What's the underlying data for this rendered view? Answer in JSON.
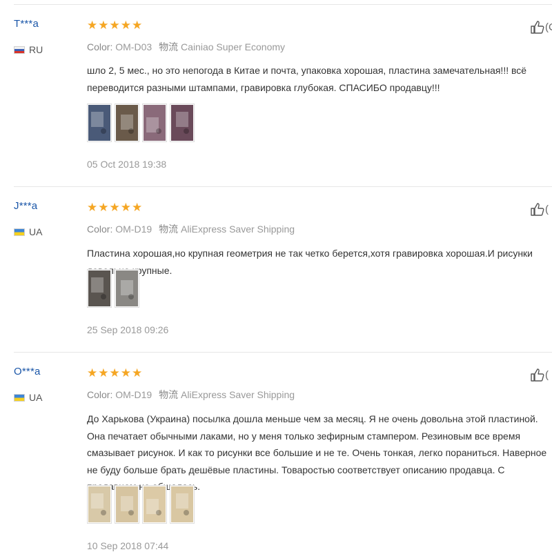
{
  "reviews": [
    {
      "user": "T***a",
      "country": "RU",
      "rating": 5,
      "color_label": "Color:",
      "color_value": "OM-D03",
      "shipping_label": "物流",
      "shipping_value": "Cainiao Super Economy",
      "text": "шло 2, 5 мес., но это непогода в Китае и почта, упаковка хорошая, пластина замечательная!!! всё переводится разными штампами, гравировка глубокая. СПАСИБО продавцу!!!",
      "date": "05 Oct 2018 19:38",
      "like_count": "(C",
      "photos": [
        "#4a5a78",
        "#6a5a4a",
        "#8a6a7a",
        "#6a4a5a"
      ]
    },
    {
      "user": "J***a",
      "country": "UA",
      "rating": 5,
      "color_label": "Color:",
      "color_value": "OM-D19",
      "shipping_label": "物流",
      "shipping_value": "AliExpress Saver Shipping",
      "text": "Пластина хорошая,но крупная геометрия не так четко берется,хотя гравировка хорошая.И рисунки довольно крупные.",
      "date": "25 Sep 2018 09:26",
      "like_count": "(",
      "photos": [
        "#5a5550",
        "#8a8884"
      ]
    },
    {
      "user": "O***a",
      "country": "UA",
      "rating": 5,
      "color_label": "Color:",
      "color_value": "OM-D19",
      "shipping_label": "物流",
      "shipping_value": "AliExpress Saver Shipping",
      "text": "До Харькова (Украина) посылка дошла меньше чем за месяц. Я не очень довольна этой пластиной. Она печатает обычными лаками, но у меня только зефирным стампером. Резиновым все время смазывает рисунок. И как то рисунки все большие и не те. Очень тонкая, легко пораниться. Наверное не буду больше брать дешёвые пластины. Товаростью соответствует описанию продавца. С продавцом не общалась.",
      "date": "10 Sep 2018 07:44",
      "like_count": "(",
      "photos": [
        "#d8c9a8",
        "#d6c4a0",
        "#dccaa6",
        "#d9c7a2"
      ]
    }
  ],
  "colors": {
    "star": "#f5a623",
    "username": "#1a56a8",
    "muted": "#999999"
  },
  "icons": {
    "like": "thumbs-up-icon"
  }
}
